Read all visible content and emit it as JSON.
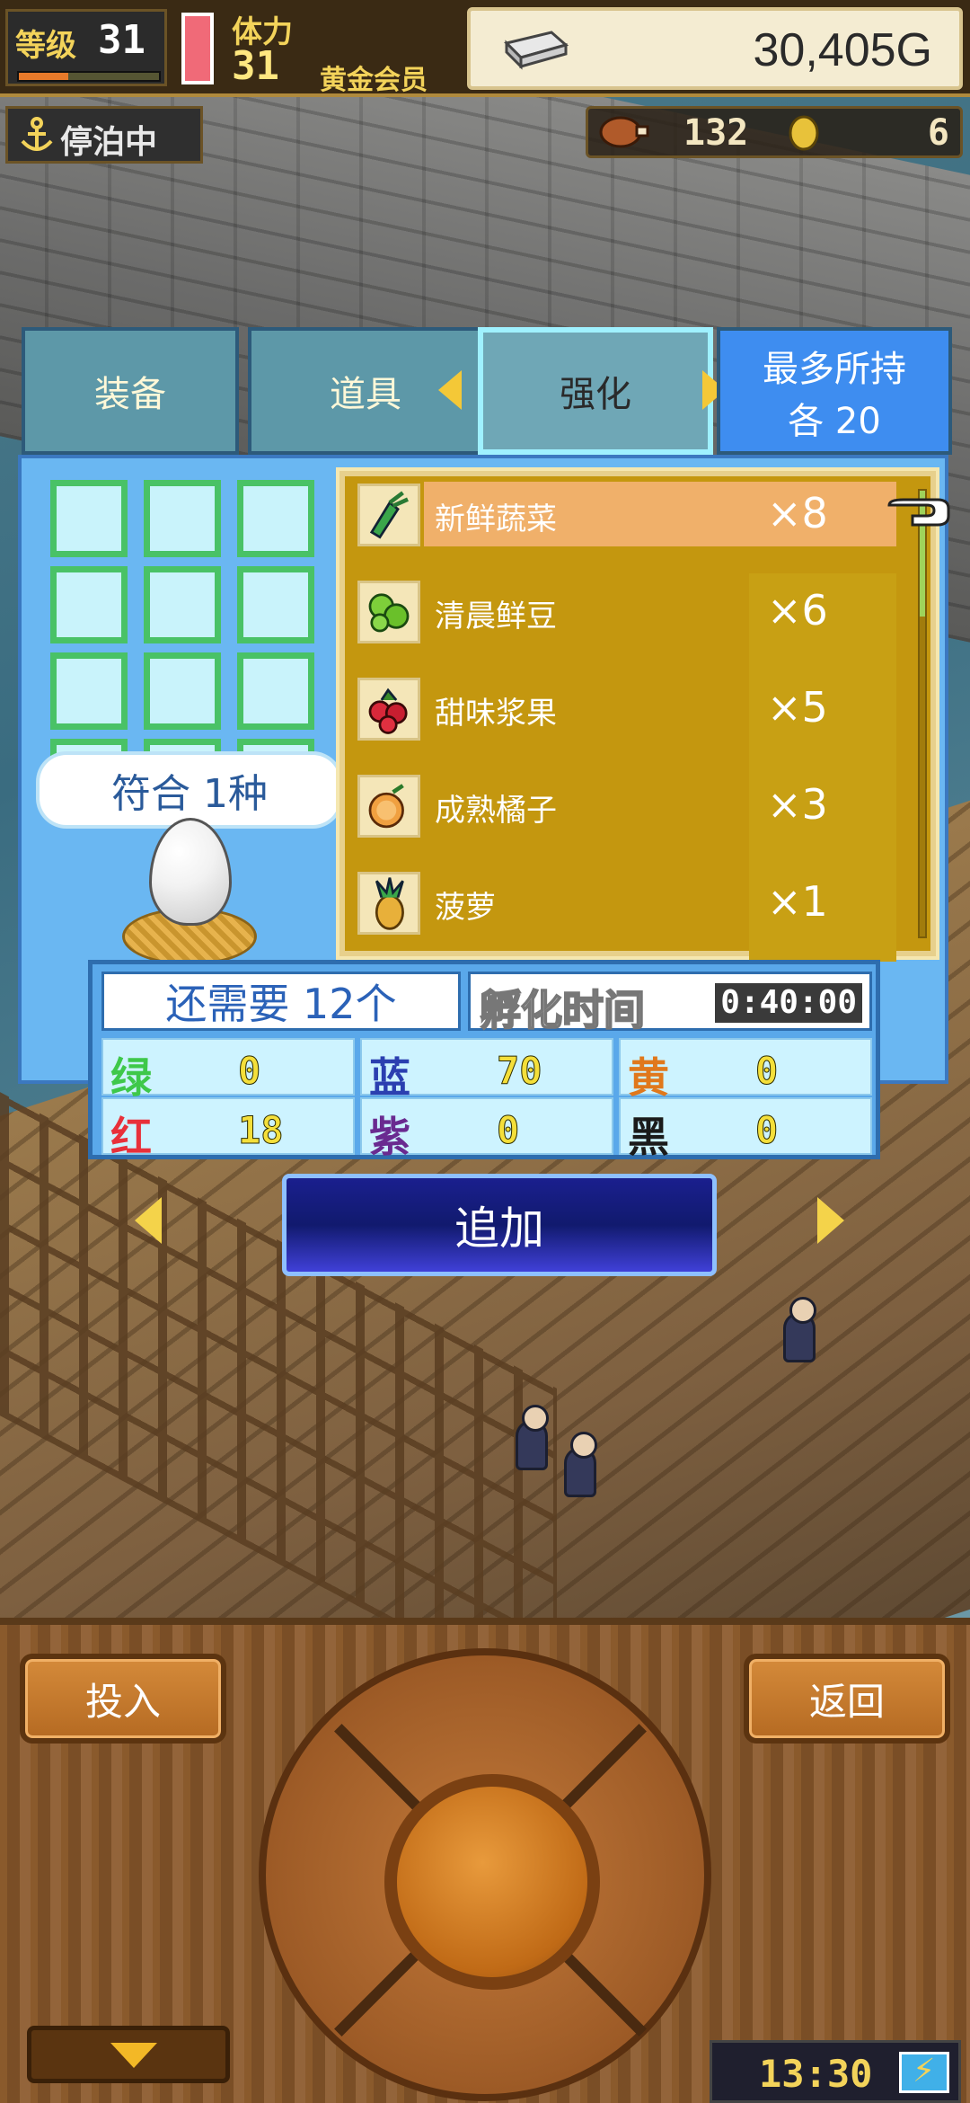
{
  "hud": {
    "level_label": "等级",
    "level": "31",
    "level_progress": 0.35,
    "stamina_label": "体力",
    "stamina": "31",
    "member_label": "黄金会员",
    "gold": "30,405G",
    "status": "停泊中",
    "food": "132",
    "coins": "6"
  },
  "tabs": {
    "equipment": "装备",
    "items": "道具",
    "enhance": "强化",
    "max_hold_label": "最多所持",
    "max_hold_value": "各 20"
  },
  "match": {
    "label": "符合 1种"
  },
  "items": [
    {
      "name": "新鲜蔬菜",
      "qty": "×8",
      "icon": "vegetable-icon",
      "selected": true
    },
    {
      "name": "清晨鲜豆",
      "qty": "×6",
      "icon": "bean-icon",
      "selected": false
    },
    {
      "name": "甜味浆果",
      "qty": "×5",
      "icon": "berry-icon",
      "selected": false
    },
    {
      "name": "成熟橘子",
      "qty": "×3",
      "icon": "orange-icon",
      "selected": false
    },
    {
      "name": "菠萝",
      "qty": "×1",
      "icon": "pineapple-icon",
      "selected": false
    }
  ],
  "stats": {
    "need": "还需要 12个",
    "hatch_label": "孵化时间",
    "hatch_time": "0:40:00",
    "green_label": "绿",
    "green": "0",
    "blue_label": "蓝",
    "blue": "70",
    "yellow_label": "黄",
    "yellow": "0",
    "red_label": "红",
    "red": "18",
    "purple_label": "紫",
    "purple": "0",
    "black_label": "黑",
    "black": "0"
  },
  "actions": {
    "add": "追加",
    "insert": "投入",
    "back": "返回"
  },
  "clock": "13:30",
  "colors": {
    "green": "#3ec84a",
    "blue": "#2b3fb0",
    "yellow": "#e0781c",
    "red": "#e8303a",
    "purple": "#6a2a90",
    "black": "#1a1a1a"
  }
}
